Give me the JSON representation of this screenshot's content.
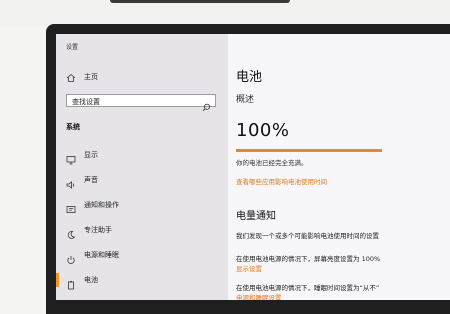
{
  "nav": {
    "app_title": "设置",
    "home_label": "主页",
    "search_placeholder": "查找设置",
    "section_label": "系统",
    "items": [
      {
        "label": "显示",
        "icon": "display-icon"
      },
      {
        "label": "声音",
        "icon": "speaker-icon"
      },
      {
        "label": "通知和操作",
        "icon": "notification-icon"
      },
      {
        "label": "专注助手",
        "icon": "moon-icon"
      },
      {
        "label": "电源和睡眠",
        "icon": "power-icon"
      },
      {
        "label": "电池",
        "icon": "battery-icon",
        "active": true
      }
    ]
  },
  "content": {
    "title": "电池",
    "overview_label": "概述",
    "battery_percent_text": "100%",
    "battery_level": 1.0,
    "status_text": "你的电池已经完全充满。",
    "apps_link": "查看哪些应用影响电池使用时间",
    "notifications_title": "电量通知",
    "notification_desc": "我们发现一个或多个可能影响电池使用时间的设置",
    "brightness_desc": "在使用电池电源的情况下，屏幕亮度设置为 100%",
    "display_link": "显示设置",
    "sleep_desc": "在使用电池电源的情况下，睡眠时间设置为“从不”",
    "power_sleep_link": "电源和睡眠设置"
  },
  "colors": {
    "accent": "#e7872a",
    "link": "#d97a1c",
    "nav_bg": "#e6e4e9",
    "content_bg": "#f7f6f9"
  }
}
